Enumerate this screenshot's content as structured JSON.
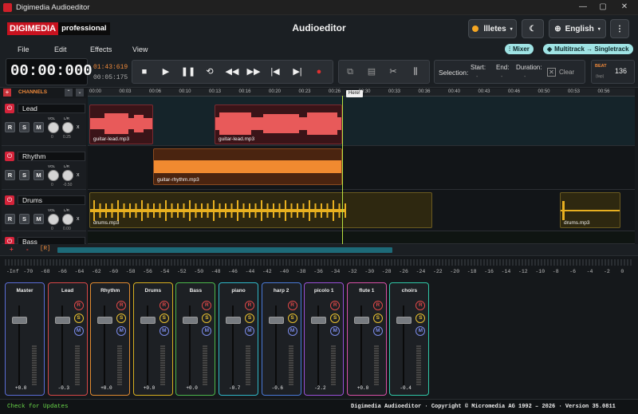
{
  "window": {
    "title": "Digimedia Audioeditor",
    "controls": [
      "—",
      "▢",
      "✕"
    ]
  },
  "header": {
    "logo_main": "DIGIMEDIA",
    "logo_sub": "professional",
    "title": "Audioeditor",
    "user": "llletes",
    "language": "English"
  },
  "menu": [
    "File",
    "Edit",
    "Effects",
    "View"
  ],
  "pills": {
    "mixer": "Mixer",
    "multitrack": "Multitrack → Singletrack"
  },
  "time": {
    "main": "00:00:000",
    "pos": "01:43:619",
    "total": "00:05:175"
  },
  "selection": {
    "label": "Selection:",
    "start": "Start:",
    "end": "End:",
    "duration": "Duration:",
    "start_v": "-",
    "end_v": "-",
    "dur_v": "-",
    "clear": "Clear"
  },
  "beat": {
    "label": "BEAT",
    "sub": "(tap)",
    "bpm": "136"
  },
  "channels_label": "CHANNELS",
  "ruler": [
    "00:00",
    "00:03",
    "00:06",
    "00:10",
    "00:13",
    "00:16",
    "00:20",
    "00:23",
    "00:26",
    "00:30",
    "00:33",
    "00:36",
    "00:40",
    "00:43",
    "00:46",
    "00:50",
    "00:53",
    "00:56"
  ],
  "playhead_label": "Here!",
  "tracks": [
    {
      "name": "Lead",
      "vol": "0",
      "lr": "0.25"
    },
    {
      "name": "Rhythm",
      "vol": "0",
      "lr": "-0.50"
    },
    {
      "name": "Drums",
      "vol": "0",
      "lr": "0.00"
    },
    {
      "name": "Bass"
    }
  ],
  "clips": {
    "lead1": "guitar-lead.mp3",
    "lead2": "guitar-lead.mp3",
    "rhythm": "guitar-rhythm.mp3",
    "drums1": "drums.mp3",
    "drums2": "drums.mp3"
  },
  "scroll": {
    "plus": "+",
    "minus": "-",
    "r": "[R]"
  },
  "db": [
    "-Inf",
    "-70",
    "-68",
    "-66",
    "-64",
    "-62",
    "-60",
    "-58",
    "-56",
    "-54",
    "-52",
    "-50",
    "-48",
    "-46",
    "-44",
    "-42",
    "-40",
    "-38",
    "-36",
    "-34",
    "-32",
    "-30",
    "-28",
    "-26",
    "-24",
    "-22",
    "-20",
    "-18",
    "-16",
    "-14",
    "-12",
    "-10",
    "-8",
    "-6",
    "-4",
    "-2",
    "0"
  ],
  "mixer": [
    {
      "name": "Master",
      "val": "+0.0",
      "color": "#5b6dd6"
    },
    {
      "name": "Lead",
      "val": "-0.3",
      "color": "#d84848"
    },
    {
      "name": "Rhythm",
      "val": "+0.0",
      "color": "#e08a30"
    },
    {
      "name": "Drums",
      "val": "+0.0",
      "color": "#d8b020"
    },
    {
      "name": "Bass",
      "val": "+0.0",
      "color": "#4cb84c"
    },
    {
      "name": "piano",
      "val": "-0.7",
      "color": "#30b8c8"
    },
    {
      "name": "harp 2",
      "val": "-0.6",
      "color": "#4a7ad8"
    },
    {
      "name": "picolo 1",
      "val": "-2.2",
      "color": "#9a50d8"
    },
    {
      "name": "flute 1",
      "val": "+0.0",
      "color": "#d850a8"
    },
    {
      "name": "choirs",
      "val": "-0.4",
      "color": "#30c8a8"
    }
  ],
  "footer": {
    "updates": "Check for Updates",
    "copyright": "Digimedia Audioeditor · Copyright © Micromedia AG 1992 – 2026 · Version 35.0811"
  }
}
